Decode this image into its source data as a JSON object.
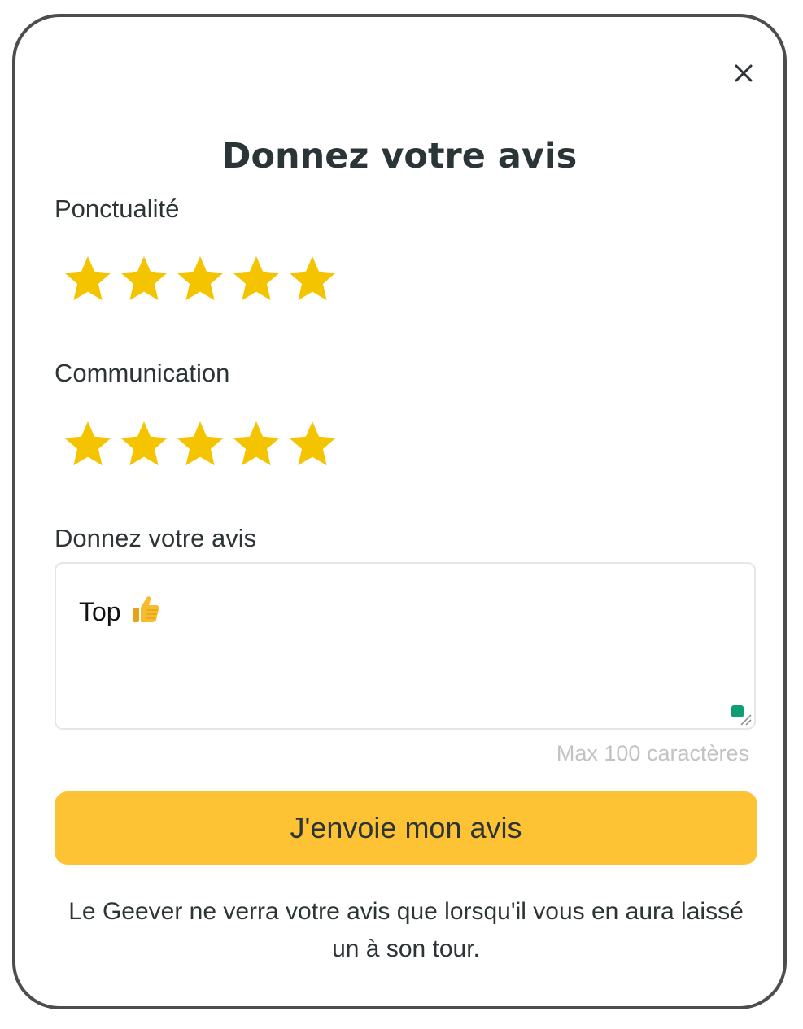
{
  "modal": {
    "title": "Donnez votre avis",
    "close_icon": "close-icon"
  },
  "ratings": [
    {
      "label": "Ponctualité",
      "value": 5,
      "max": 5,
      "icon": "star-icon"
    },
    {
      "label": "Communication",
      "value": 5,
      "max": 5,
      "icon": "star-icon"
    }
  ],
  "review": {
    "label": "Donnez votre avis",
    "value": "Top",
    "emoji_icon": "thumbs-up-icon",
    "char_limit": "Max 100 caractères"
  },
  "submit": {
    "label": "J'envoie mon avis"
  },
  "footnote": {
    "text": "Le Geever ne verra votre avis que lorsqu'il vous en aura laissé un à son tour."
  },
  "colors": {
    "star": "#f5c400",
    "button": "#fec335",
    "text": "#2d3436",
    "muted": "#c2c2c2",
    "border": "#4d4d4d",
    "resize_handle": "#0f9d74"
  }
}
